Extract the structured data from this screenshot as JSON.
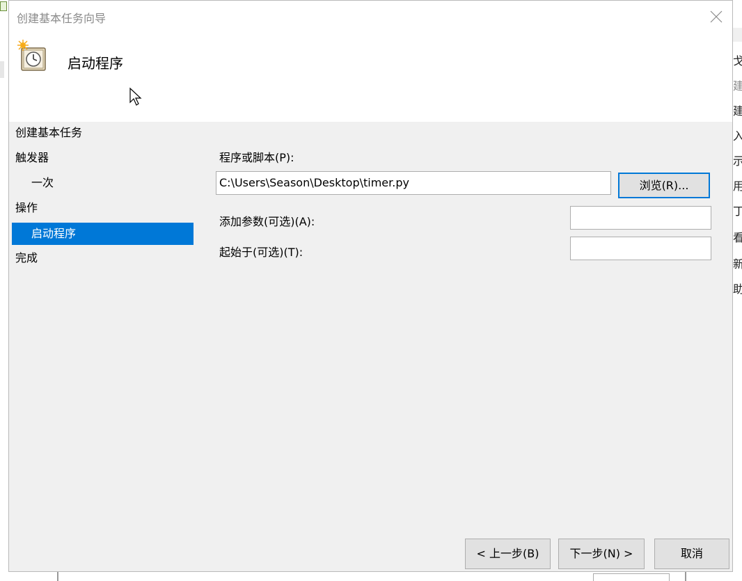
{
  "dialog": {
    "title": "创建基本任务向导",
    "header_title": "启动程序"
  },
  "nav": {
    "items": [
      {
        "label": "创建基本任务",
        "level": 0,
        "selected": false
      },
      {
        "label": "触发器",
        "level": 0,
        "selected": false
      },
      {
        "label": "一次",
        "level": 1,
        "selected": false
      },
      {
        "label": "操作",
        "level": 0,
        "selected": false
      },
      {
        "label": "启动程序",
        "level": 1,
        "selected": true
      },
      {
        "label": "完成",
        "level": 0,
        "selected": false
      }
    ]
  },
  "form": {
    "program_label": "程序或脚本(P):",
    "program_value": "C:\\Users\\Season\\Desktop\\timer.py",
    "browse_label": "浏览(R)...",
    "args_label": "添加参数(可选)(A):",
    "args_value": "",
    "start_in_label": "起始于(可选)(T):",
    "start_in_value": ""
  },
  "footer": {
    "back_label": "< 上一步(B)",
    "next_label": "下一步(N) >",
    "cancel_label": "取消"
  },
  "background_window": {
    "right_items": [
      "戈",
      "建",
      "建",
      "入",
      "示",
      "用",
      "丁",
      "看",
      "新",
      "助"
    ]
  },
  "colors": {
    "accent": "#0078d7",
    "dialog_bg": "#f0f0f0",
    "header_bg": "#ffffff"
  }
}
